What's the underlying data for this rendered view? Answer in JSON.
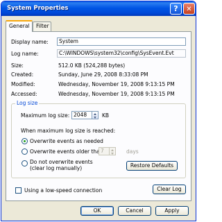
{
  "window": {
    "title": "System Properties"
  },
  "titlebar": {
    "help_glyph": "?",
    "close_glyph": "✕"
  },
  "tabs": [
    {
      "label": "General",
      "active": true
    },
    {
      "label": "Filter",
      "active": false
    }
  ],
  "general": {
    "display_name_label": "Display name:",
    "display_name_value": "System",
    "log_name_label": "Log name:",
    "log_name_value": "C:\\WINDOWS\\system32\\config\\SysEvent.Evt",
    "size_label": "Size:",
    "size_value": "512.0 KB (524,288 bytes)",
    "created_label": "Created:",
    "created_value": "Sunday, June 29, 2008 8:33:08 PM",
    "modified_label": "Modified:",
    "modified_value": "Wednesday, November 19, 2008 9:13:15 PM",
    "accessed_label": "Accessed:",
    "accessed_value": "Wednesday, November 19, 2008 9:13:15 PM"
  },
  "log_size": {
    "group_title": "Log size",
    "max_size_label": "Maximum log size:",
    "max_size_value": "2048",
    "max_size_unit": "KB",
    "when_reached_label": "When maximum log size is reached:",
    "options": {
      "overwrite_as_needed": "Overwrite events as needed",
      "overwrite_older": "Overwrite events older than",
      "older_days_value": "7",
      "days_unit": "days",
      "do_not_overwrite_line1": "Do not overwrite events",
      "do_not_overwrite_line2": "(clear log manually)"
    },
    "selected_option": "overwrite_as_needed",
    "restore_defaults_label": "Restore Defaults"
  },
  "low_speed": {
    "label": "Using a low-speed connection",
    "checked": false
  },
  "clear_log_label": "Clear Log",
  "footer": {
    "ok_label": "OK",
    "cancel_label": "Cancel",
    "apply_label": "Apply"
  }
}
